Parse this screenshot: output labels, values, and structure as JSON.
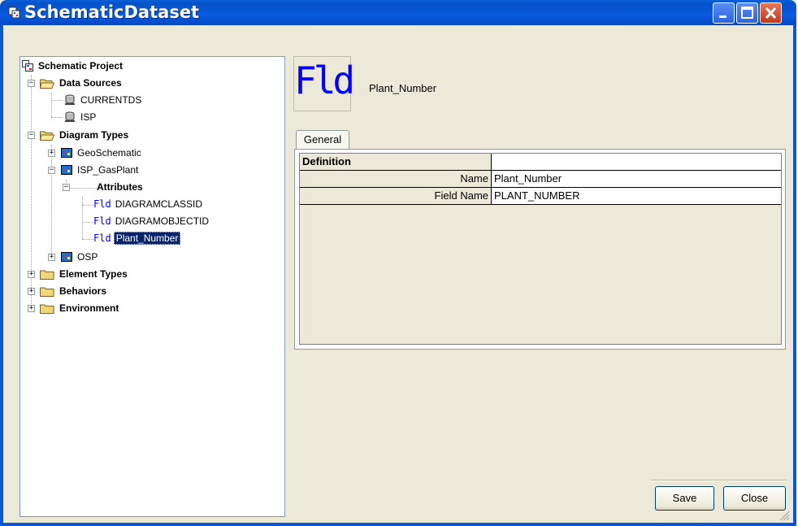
{
  "window": {
    "title": "SchematicDataset",
    "title_icon": "schematic-dataset-icon",
    "controls": [
      "minimize",
      "maximize",
      "close"
    ]
  },
  "tree": {
    "root": "Schematic Project",
    "data_sources": "Data Sources",
    "currentds": "CURRENTDS",
    "isp_source": "ISP",
    "diagram_types": "Diagram Types",
    "geoschematic": "GeoSchematic",
    "isp_gasplant": "ISP_GasPlant",
    "attributes": "Attributes",
    "fld1": "DIAGRAMCLASSID",
    "fld2": "DIAGRAMOBJECTID",
    "fld3": "Plant_Number",
    "osp": "OSP",
    "element_types": "Element Types",
    "behaviors": "Behaviors",
    "environment": "Environment",
    "fld_prefix": "Fld",
    "selected_item": "Plant_Number"
  },
  "details": {
    "icon_text": "Fld",
    "name": "Plant_Number",
    "tab": "General",
    "section": "Definition",
    "rows": [
      {
        "label": "Name",
        "value": "Plant_Number"
      },
      {
        "label": "Field Name",
        "value": "PLANT_NUMBER"
      }
    ]
  },
  "buttons": {
    "save": "Save",
    "close": "Close"
  },
  "colors": {
    "titlebar": "#0a56d4",
    "selection": "#0a246a",
    "field_icon": "#0000ff",
    "close_button": "#c1391b"
  }
}
